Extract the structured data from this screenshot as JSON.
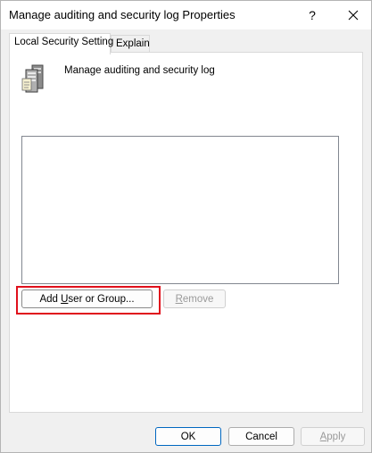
{
  "window": {
    "title": "Manage auditing and security log Properties",
    "help_label": "?",
    "close_label": "✕"
  },
  "tabs": [
    {
      "label": "Local Security Setting",
      "active": true
    },
    {
      "label": "Explain",
      "active": false
    }
  ],
  "policy": {
    "icon": "server-policy-icon",
    "name": "Manage auditing and security log"
  },
  "assigned_list": {
    "items": []
  },
  "actions": {
    "add_prefix": "Add ",
    "add_mnemonic": "U",
    "add_suffix": "ser or Group...",
    "remove_mnemonic": "R",
    "remove_suffix": "emove",
    "remove_enabled": false
  },
  "footer": {
    "ok_label": "OK",
    "cancel_label": "Cancel",
    "apply_mnemonic": "A",
    "apply_suffix": "pply",
    "apply_enabled": false
  },
  "colors": {
    "highlight": "#e0101c",
    "default_button_border": "#0067c0"
  }
}
